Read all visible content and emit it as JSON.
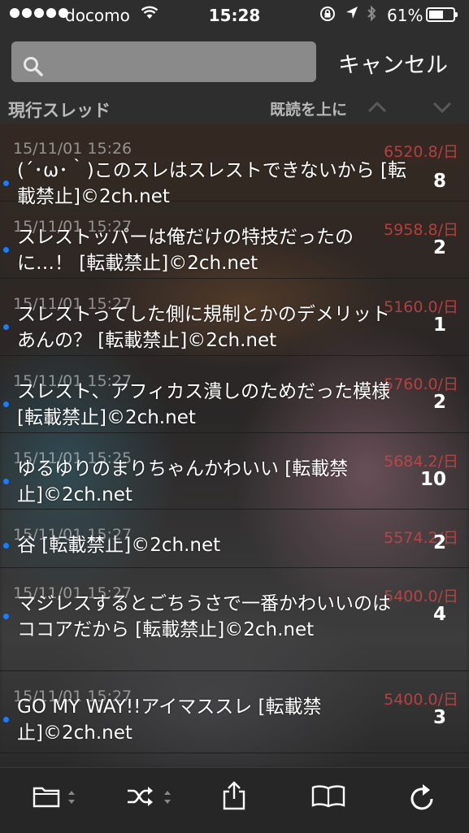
{
  "status_bar": {
    "carrier": "docomo",
    "time": "15:28",
    "battery": "61%",
    "battery_level": 0.61
  },
  "search": {
    "placeholder": "",
    "cancel_label": "キャンセル"
  },
  "section": {
    "title": "現行スレッド",
    "sort_label": "既読を上に"
  },
  "threads": [
    {
      "date": "15/11/01 15:26",
      "speed": "6520.8/日",
      "title": "(´･ω･｀)このスレはスレストできないから [転載禁止]©2ch.net",
      "count": "8",
      "unread": true
    },
    {
      "date": "15/11/01 15:27",
      "speed": "5958.8/日",
      "title": "スレストッパーは俺だけの特技だったのに…！ [転載禁止]©2ch.net",
      "count": "2",
      "unread": true
    },
    {
      "date": "15/11/01 15:27",
      "speed": "5160.0/日",
      "title": "スレストってした側に規制とかのデメリットあんの？ [転載禁止]©2ch.net",
      "count": "1",
      "unread": true
    },
    {
      "date": "15/11/01 15:27",
      "speed": "5760.0/日",
      "title": "スレスト、アフィカス潰しのためだった模様 [転載禁止]©2ch.net",
      "count": "2",
      "unread": true
    },
    {
      "date": "15/11/01 15:25",
      "speed": "5684.2/日",
      "title": "ゆるゆりのまりちゃんかわいい [転載禁止]©2ch.net",
      "count": "10",
      "unread": true
    },
    {
      "date": "15/11/01 15:27",
      "speed": "5574.2/日",
      "title": "谷 [転載禁止]©2ch.net",
      "count": "2",
      "unread": true
    },
    {
      "date": "15/11/01 15:27",
      "speed": "5400.0/日",
      "title": "マジレスするとごちうさで一番かわいいのはココアだから [転載禁止]©2ch.net",
      "count": "4",
      "unread": true
    },
    {
      "date": "15/11/01 15:27",
      "speed": "5400.0/日",
      "title": "GO MY WAY!!アイマススレ [転載禁止]©2ch.net",
      "count": "3",
      "unread": true
    }
  ],
  "toolbar": {
    "items": [
      "folder-icon",
      "shuffle-icon",
      "share-icon",
      "book-icon",
      "refresh-icon"
    ]
  }
}
